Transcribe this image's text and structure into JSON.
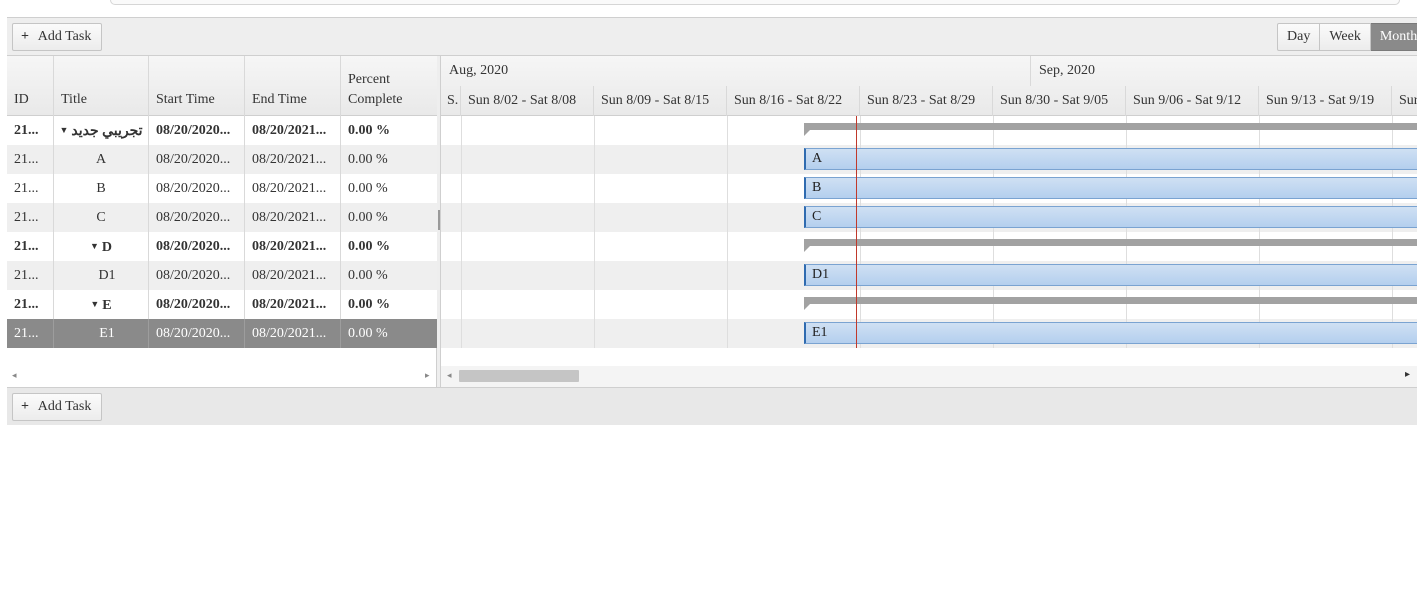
{
  "toolbar": {
    "add_task_label": "Add Task",
    "views": [
      {
        "label": "Day",
        "active": false
      },
      {
        "label": "Week",
        "active": false
      },
      {
        "label": "Month",
        "active": true
      }
    ]
  },
  "grid": {
    "columns": {
      "id": "ID",
      "title": "Title",
      "start": "Start Time",
      "end": "End Time",
      "percent_line1": "Percent",
      "percent_line2": "Complete"
    },
    "rows": [
      {
        "id": "21...",
        "title": "تجريبي جديد",
        "start": "08/20/2020...",
        "end": "08/20/2021...",
        "percent": "0.00 %",
        "summary": true
      },
      {
        "id": "21...",
        "title": "A",
        "start": "08/20/2020...",
        "end": "08/20/2021...",
        "percent": "0.00 %",
        "summary": false
      },
      {
        "id": "21...",
        "title": "B",
        "start": "08/20/2020...",
        "end": "08/20/2021...",
        "percent": "0.00 %",
        "summary": false
      },
      {
        "id": "21...",
        "title": "C",
        "start": "08/20/2020...",
        "end": "08/20/2021...",
        "percent": "0.00 %",
        "summary": false
      },
      {
        "id": "21...",
        "title": "D",
        "start": "08/20/2020...",
        "end": "08/20/2021...",
        "percent": "0.00 %",
        "summary": true
      },
      {
        "id": "21...",
        "title": "D1",
        "start": "08/20/2020...",
        "end": "08/20/2021...",
        "percent": "0.00 %",
        "summary": false
      },
      {
        "id": "21...",
        "title": "E",
        "start": "08/20/2020...",
        "end": "08/20/2021...",
        "percent": "0.00 %",
        "summary": true
      },
      {
        "id": "21...",
        "title": "E1",
        "start": "08/20/2020...",
        "end": "08/20/2021...",
        "percent": "0.00 %",
        "summary": false,
        "selected": true
      }
    ]
  },
  "timeline": {
    "months": [
      "Aug, 2020",
      "Sep, 2020"
    ],
    "weeks": [
      "S.",
      "Sun 8/02 - Sat 8/08",
      "Sun 8/09 - Sat 8/15",
      "Sun 8/16 - Sat 8/22",
      "Sun 8/23 - Sat 8/29",
      "Sun 8/30 - Sat 9/05",
      "Sun 9/06 - Sat 9/12",
      "Sun 9/13 - Sat 9/19",
      "Sur"
    ],
    "bars": [
      "",
      "A",
      "B",
      "C",
      "",
      "D1",
      "",
      "E1"
    ]
  },
  "colors": {
    "task_bar": "#b4cfee",
    "task_bar_edge": "#2f6bb0",
    "summary_bar": "#a2a2a2",
    "today_line": "#c0392b",
    "selected_row": "#8a8a8a"
  }
}
